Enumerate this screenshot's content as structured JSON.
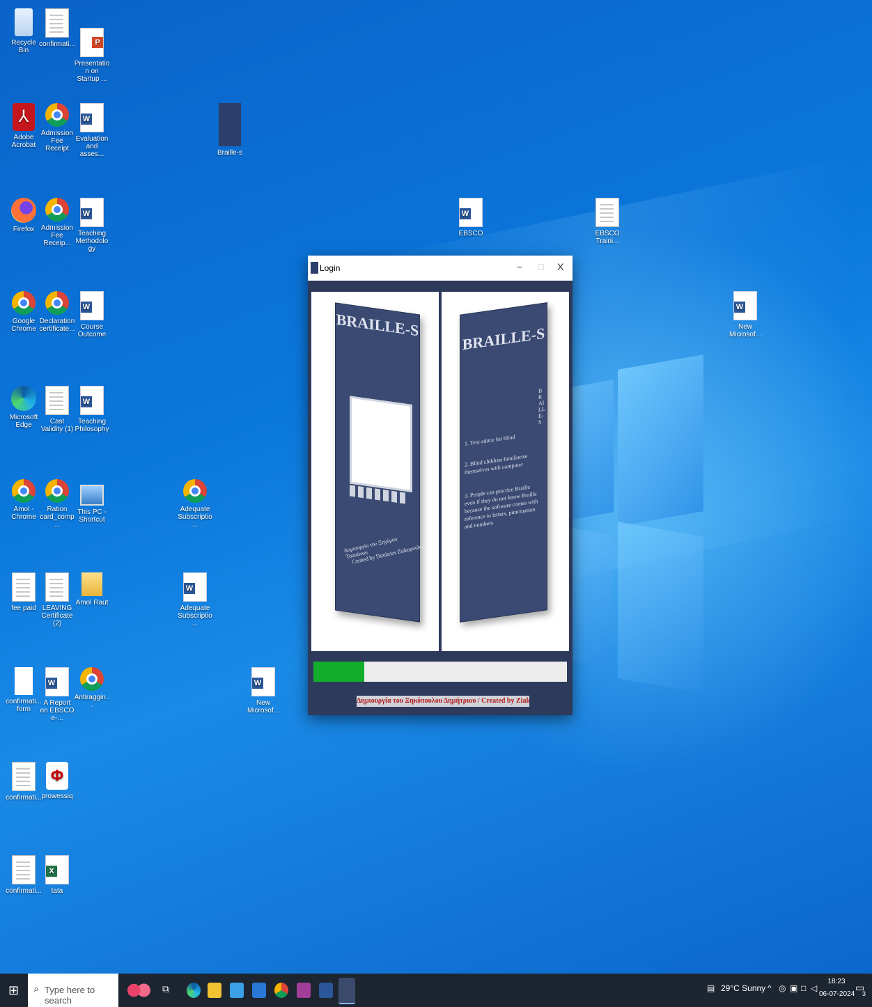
{
  "desktop_icons": [
    {
      "label": "Recycle Bin",
      "type": "recycle"
    },
    {
      "label": "confirmati...",
      "type": "doc"
    },
    {
      "label": "Presentation on Startup ...",
      "type": "ppt"
    },
    {
      "label": "Adobe Acrobat",
      "type": "acrobat"
    },
    {
      "label": "Admission Fee Receipt",
      "type": "chrome"
    },
    {
      "label": "Evaluation and asses...",
      "type": "word"
    },
    {
      "label": "Braille-s",
      "type": "braille"
    },
    {
      "label": "Firefox",
      "type": "firefox"
    },
    {
      "label": "Admission Fee Receip...",
      "type": "chrome"
    },
    {
      "label": "Teaching Methodology",
      "type": "word"
    },
    {
      "label": "EBSCO",
      "type": "word"
    },
    {
      "label": "EBSCO Traini...",
      "type": "doc"
    },
    {
      "label": "Google Chrome",
      "type": "chrome"
    },
    {
      "label": "Declaration certificate...",
      "type": "chrome"
    },
    {
      "label": "Course Outcome",
      "type": "word"
    },
    {
      "label": "New Microsof...",
      "type": "word"
    },
    {
      "label": "Microsoft Edge",
      "type": "edge"
    },
    {
      "label": "Cast Validity (1)",
      "type": "doc"
    },
    {
      "label": "Teaching Philosophy",
      "type": "word"
    },
    {
      "label": "Amol - Chrome",
      "type": "chrome"
    },
    {
      "label": "Ration card_comp...",
      "type": "chrome"
    },
    {
      "label": "This PC - Shortcut",
      "type": "pc"
    },
    {
      "label": "Adequate Subscriptio...",
      "type": "chrome"
    },
    {
      "label": "fee paid",
      "type": "doc"
    },
    {
      "label": "LEAVING Certificate (2)",
      "type": "doc"
    },
    {
      "label": "Amol Raut",
      "type": "folder"
    },
    {
      "label": "Adequate Subscriptio...",
      "type": "word"
    },
    {
      "label": "confirmati... form",
      "type": "blank"
    },
    {
      "label": "A Report on EBSCO e-...",
      "type": "word"
    },
    {
      "label": "Antiraggin...",
      "type": "chrome"
    },
    {
      "label": "New Microsof...",
      "type": "word"
    },
    {
      "label": "confirmati...",
      "type": "doc"
    },
    {
      "label": "prowessiq",
      "type": "prowess"
    },
    {
      "label": "confirmati...",
      "type": "doc"
    },
    {
      "label": "tata",
      "type": "excel"
    }
  ],
  "window": {
    "title": "Login",
    "minimize": "−",
    "maximize": "□",
    "close": "X",
    "book_title": "BRAILLE-S",
    "book_spine": "BRAILLE-S",
    "book_front_caption_1": "Δημιουργία του Ξηγέμου Τσαπάνου",
    "book_front_caption_2": "Created by Dimitrios Ziakopoulos",
    "book_back_points": [
      "1. Text editor for blind",
      "2. Blind children familiarise themselves with computer",
      "3. People can practice Braille even if they do not know Braille because the software comes with reference to letters, punctuation and numbers"
    ],
    "progress_fraction": 0.2,
    "credit": "Δημιουργία του Ξηκόπουλου Δημήτριου / Created by Ziakopoulos Dimitrios"
  },
  "taskbar": {
    "search_placeholder": "Type here to search",
    "weather": "29°C  Sunny",
    "time": "18:23",
    "date": "06-07-2024",
    "notification_count": "3"
  }
}
